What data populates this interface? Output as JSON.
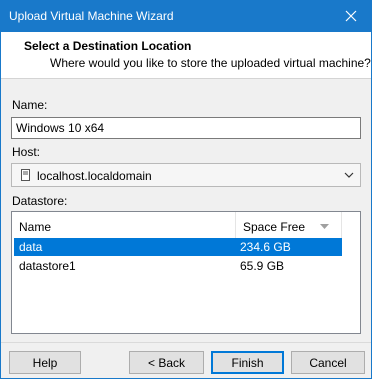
{
  "window": {
    "title": "Upload Virtual Machine Wizard",
    "close_icon": "close-icon"
  },
  "header": {
    "heading": "Select a Destination Location",
    "subheading": "Where would you like to store the uploaded virtual machine?"
  },
  "form": {
    "name_label": "Name:",
    "name_value": "Windows 10 x64",
    "host_label": "Host:",
    "host_value": "localhost.localdomain",
    "host_icon": "server-icon",
    "datastore_label": "Datastore:"
  },
  "datastore_table": {
    "columns": [
      "Name",
      "Space Free"
    ],
    "sort_icon": "sort-descending-icon",
    "rows": [
      {
        "name": "data",
        "space_free": "234.6 GB",
        "selected": true
      },
      {
        "name": "datastore1",
        "space_free": "65.9 GB",
        "selected": false
      }
    ]
  },
  "buttons": {
    "help": "Help",
    "back": "< Back",
    "finish": "Finish",
    "cancel": "Cancel"
  },
  "colors": {
    "titlebar": "#1979ca",
    "selection": "#0078d7"
  }
}
